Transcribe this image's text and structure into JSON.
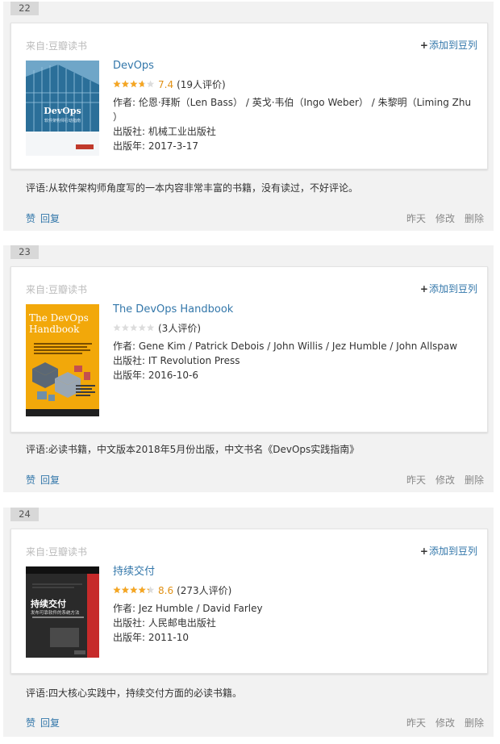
{
  "ui": {
    "source_prefix": "来自:",
    "source_name": "豆瓣读书",
    "add_list_label": "添加到豆列",
    "comment_prefix": "评语:",
    "like_label": "赞",
    "reply_label": "回复",
    "time_label": "昨天",
    "edit_label": "修改",
    "delete_label": "删除"
  },
  "items": [
    {
      "index": "22",
      "title": "DevOps",
      "rating_value": 7.4,
      "score": "7.4",
      "votes": "(19人评价)",
      "author": "作者: 伦恩·拜斯（Len Bass） / 英戈·韦伯（Ingo Weber） / 朱黎明（Liming Zhu ）",
      "publisher": "出版社: 机械工业出版社",
      "pubdate": "出版年: 2017-3-17",
      "comment": "从软件架构师角度写的一本内容非常丰富的书籍，没有读过，不好评论。",
      "cover": {
        "title": "DevOps",
        "subtitle": "软件架构师行动指南"
      }
    },
    {
      "index": "23",
      "title": "The DevOps Handbook",
      "rating_value": 0,
      "score": "",
      "votes": "(3人评价)",
      "author": "作者: Gene Kim / Patrick Debois / John Willis / Jez Humble / John Allspaw",
      "publisher": "出版社: IT Revolution Press",
      "pubdate": "出版年: 2016-10-6",
      "comment": "必读书籍，中文版本2018年5月份出版，中文书名《DevOps实践指南》",
      "cover": {
        "title": "The DevOps Handbook"
      }
    },
    {
      "index": "24",
      "title": "持续交付",
      "rating_value": 8.6,
      "score": "8.6",
      "votes": "(273人评价)",
      "author": "作者: Jez Humble / David Farley",
      "publisher": "出版社: 人民邮电出版社",
      "pubdate": "出版年: 2011-10",
      "comment": "四大核心实践中，持续交付方面的必读书籍。",
      "cover": {
        "title": "持续交付",
        "subtitle": "发布可靠软件的系统方法"
      }
    }
  ],
  "colors": {
    "link": "#3377aa",
    "star": "#f5a623",
    "score": "#e09015"
  }
}
